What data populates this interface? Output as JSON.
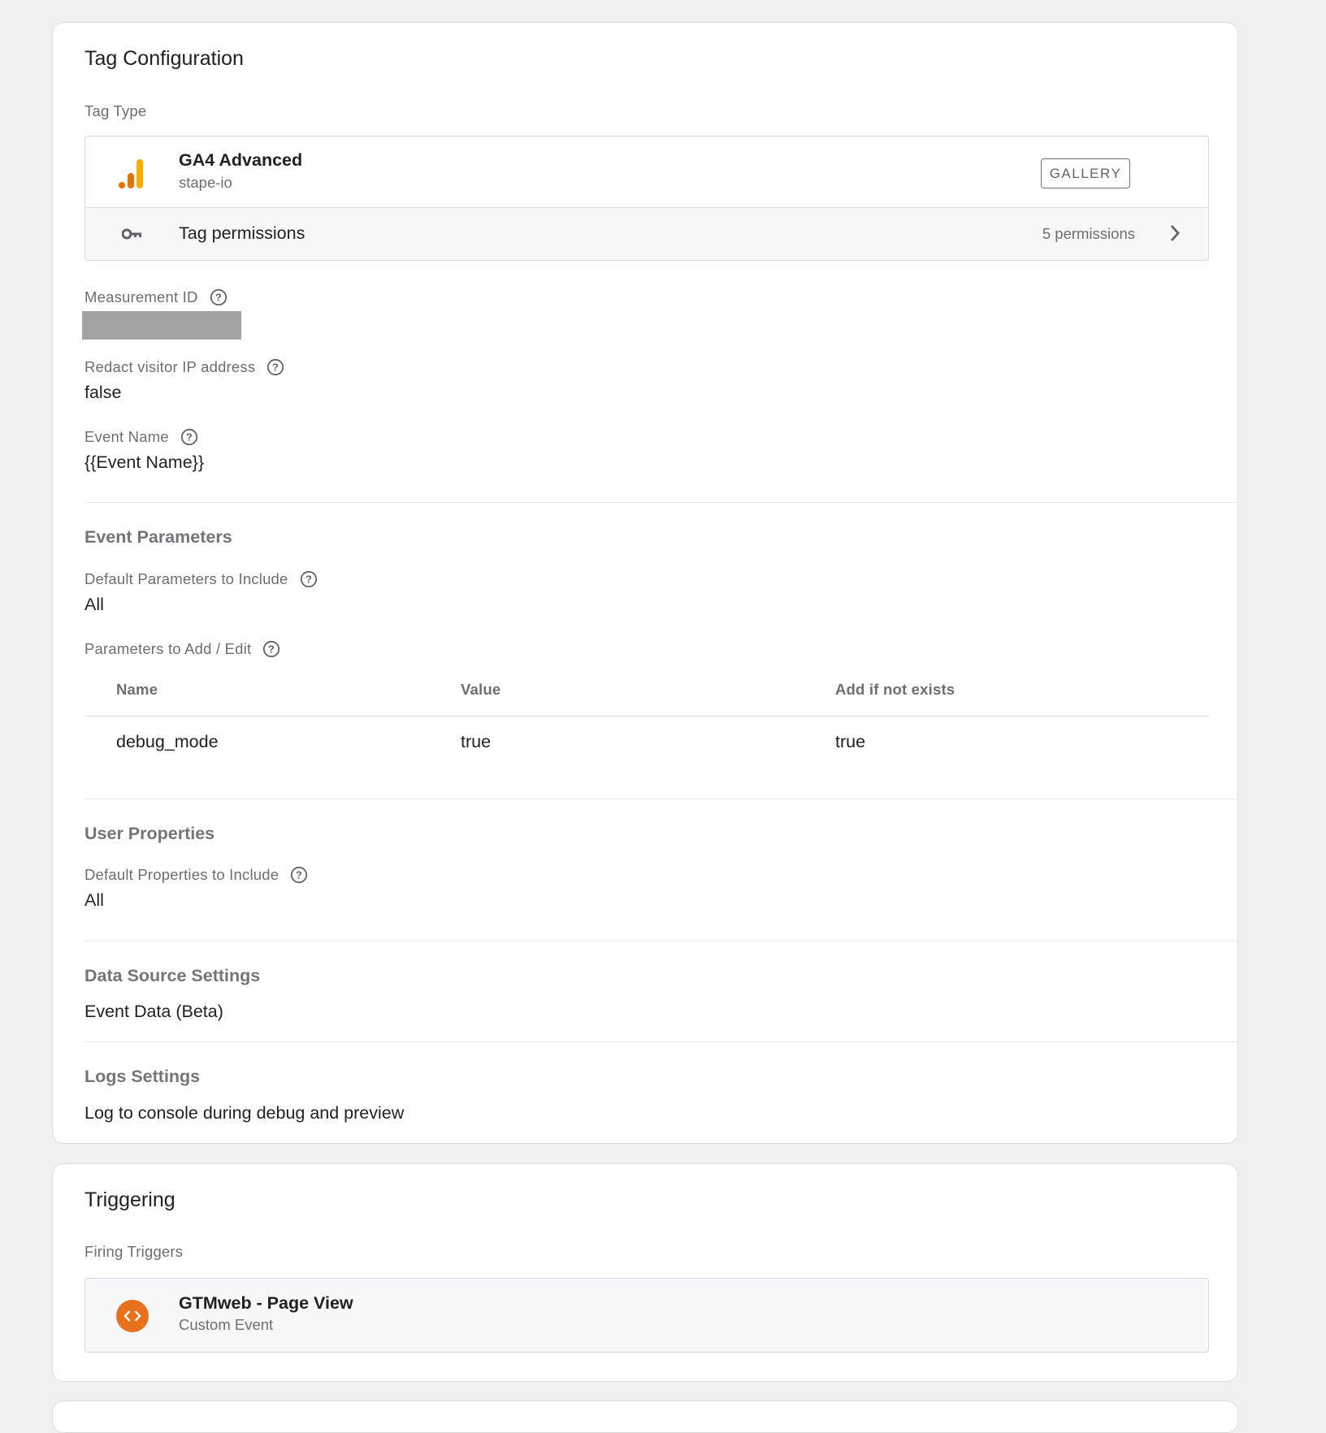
{
  "tag_configuration": {
    "title": "Tag Configuration",
    "tag_type_label": "Tag Type",
    "tag_type": {
      "name": "GA4 Advanced",
      "vendor": "stape-io",
      "icon": "analytics-bars-icon",
      "gallery_button": "GALLERY",
      "permissions_label": "Tag permissions",
      "permissions_count": "5 permissions",
      "permissions_icon": "key-icon"
    },
    "fields": {
      "measurement_id_label": "Measurement ID",
      "redact_ip_label": "Redact visitor IP address",
      "redact_ip_value": "false",
      "event_name_label": "Event Name",
      "event_name_value": "{{Event Name}}"
    },
    "event_parameters": {
      "title": "Event Parameters",
      "default_params_label": "Default Parameters to Include",
      "default_params_value": "All",
      "params_to_add_label": "Parameters to Add / Edit",
      "table": {
        "headers": [
          "Name",
          "Value",
          "Add if not exists"
        ],
        "rows": [
          [
            "debug_mode",
            "true",
            "true"
          ]
        ]
      }
    },
    "user_properties": {
      "title": "User Properties",
      "default_props_label": "Default Properties to Include",
      "default_props_value": "All"
    },
    "data_source": {
      "title": "Data Source Settings",
      "value": "Event Data (Beta)"
    },
    "logs": {
      "title": "Logs Settings",
      "value": "Log to console during debug and preview"
    }
  },
  "triggering": {
    "title": "Triggering",
    "firing_label": "Firing Triggers",
    "trigger": {
      "name": "GTMweb - Page View",
      "type": "Custom Event",
      "icon": "code-brackets-icon"
    }
  },
  "colors": {
    "background": "#eff0f2",
    "ga_orange_light": "#f9ab00",
    "ga_orange_dark": "#e37400",
    "trigger_orange": "#e8711c"
  }
}
